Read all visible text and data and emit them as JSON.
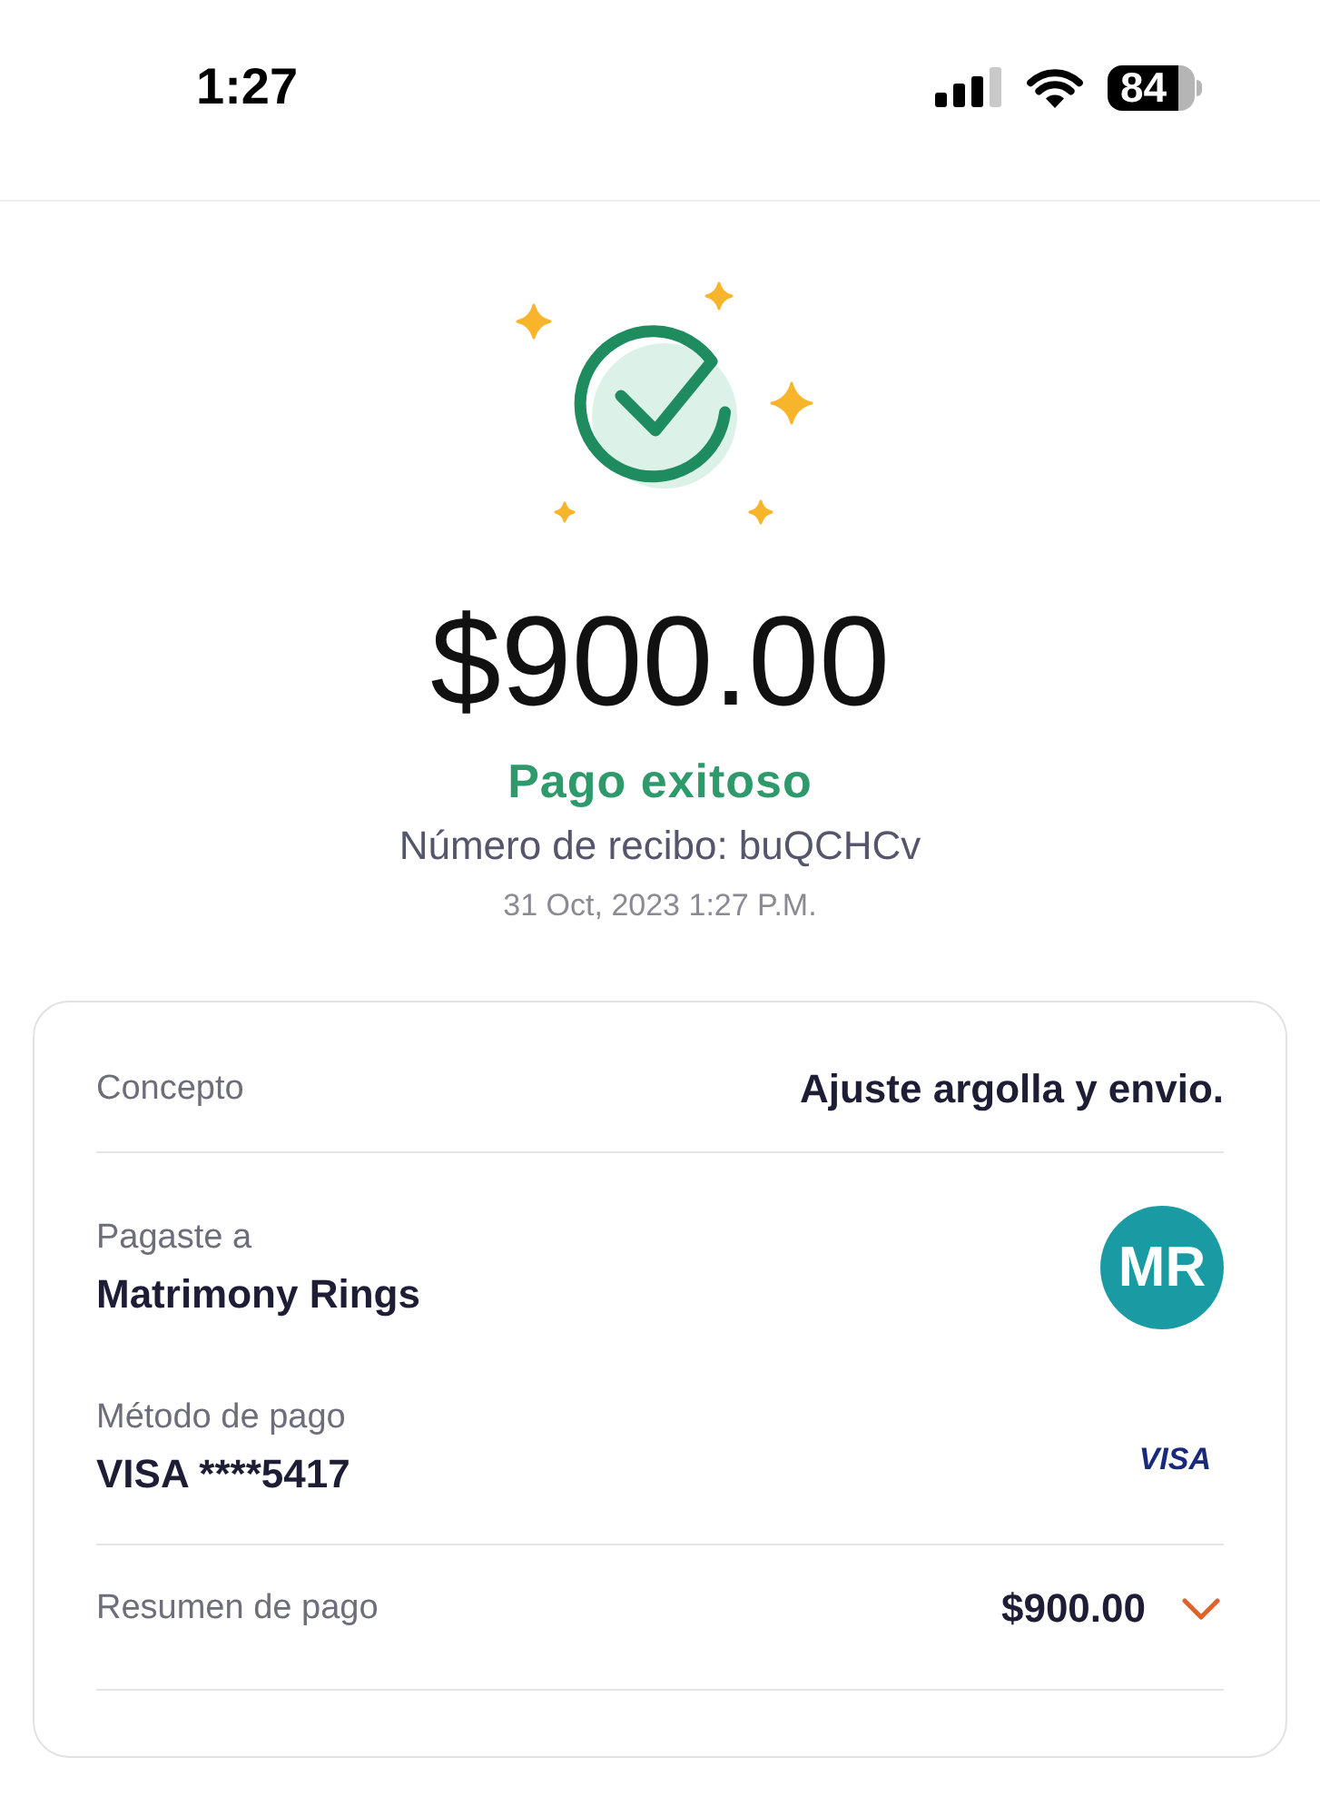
{
  "status_bar": {
    "time": "1:27",
    "battery": "84"
  },
  "receipt": {
    "amount": "$900.00",
    "status": "Pago exitoso",
    "receipt_number": "Número de recibo: buQCHCv",
    "date": "31 Oct, 2023 1:27 P.M."
  },
  "details": [
    {
      "kind": "inline",
      "label": "Concepto",
      "value": "Ajuste argolla y envio."
    },
    {
      "kind": "avatar",
      "label": "Pagaste a",
      "value": "Matrimony Rings",
      "avatar": "MR"
    },
    {
      "kind": "card",
      "label": "Método de pago",
      "value": "VISA ****5417",
      "brand": "VISA"
    },
    {
      "kind": "expandable",
      "label": "Resumen de pago",
      "value": "$900.00",
      "expanded": false
    }
  ]
}
